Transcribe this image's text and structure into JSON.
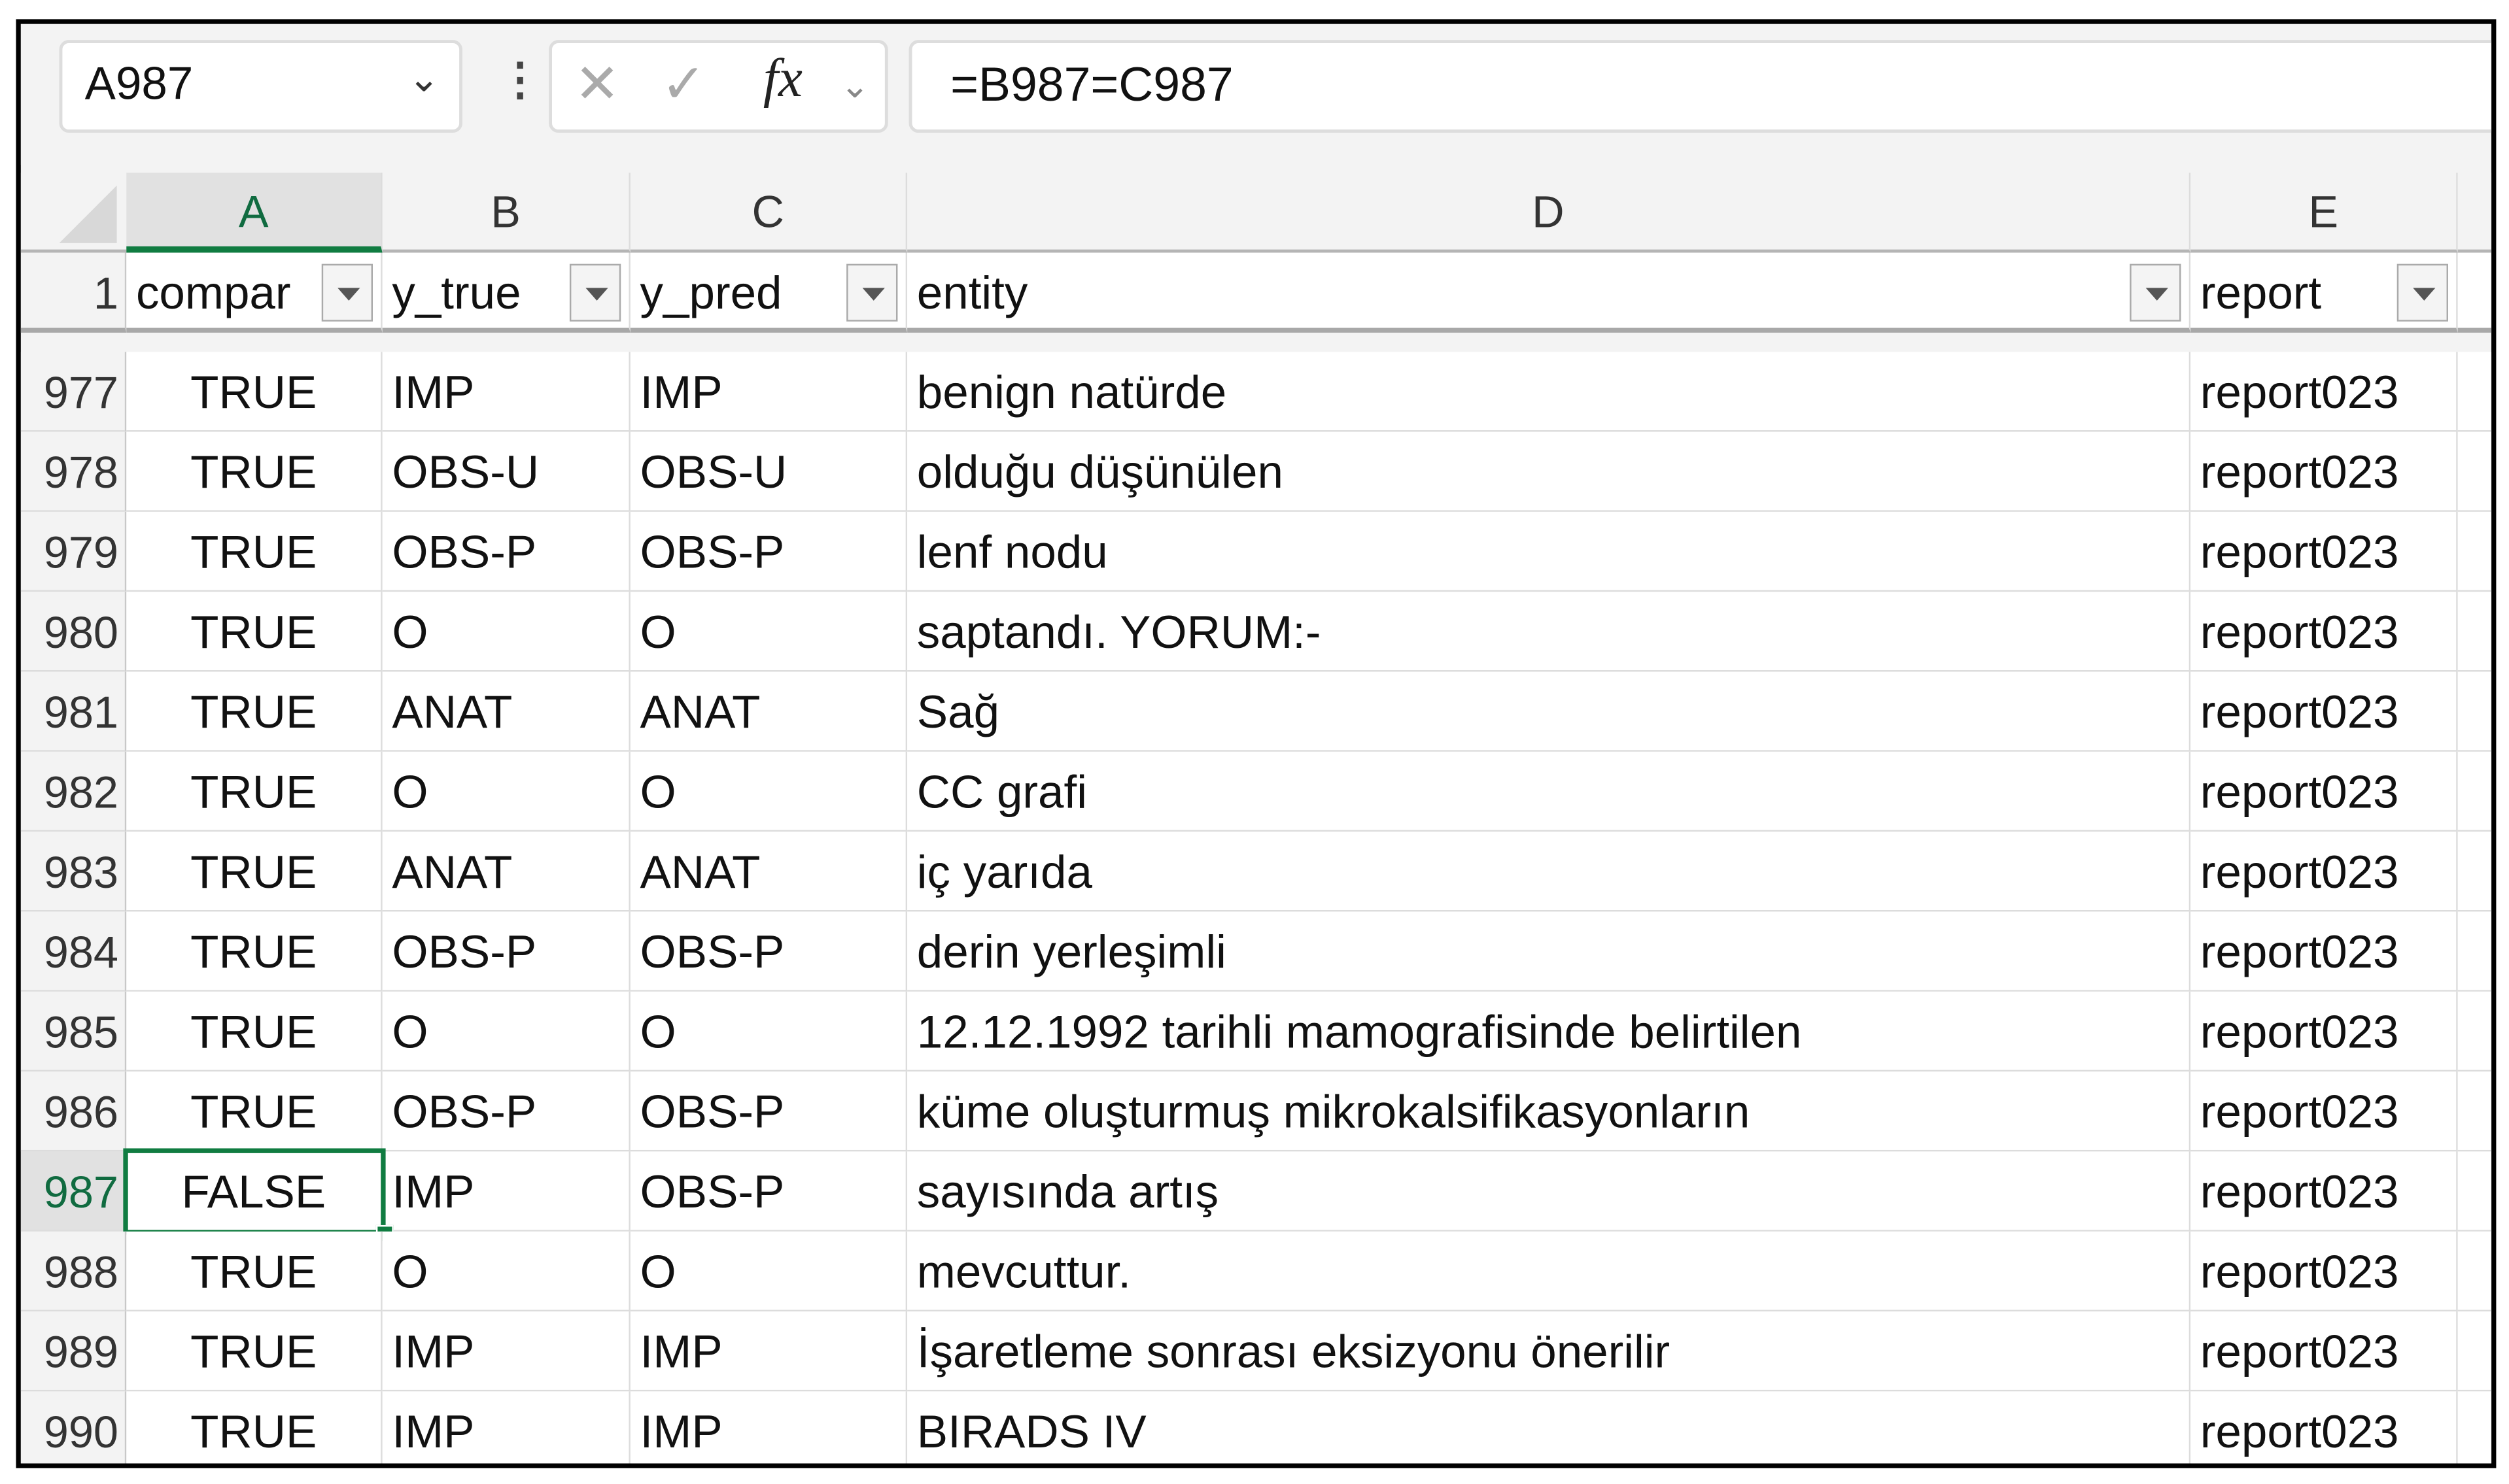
{
  "name_box": {
    "value": "A987"
  },
  "formula_bar": {
    "value": "=B987=C987",
    "cancel_icon": "x-icon",
    "enter_icon": "check-icon",
    "fx_label": "fx"
  },
  "columns": [
    "A",
    "B",
    "C",
    "D",
    "E"
  ],
  "header_row": {
    "number": "1",
    "cells": [
      "compar",
      "y_true",
      "y_pred",
      "entity",
      "report"
    ]
  },
  "selected_cell": "A987",
  "colors": {
    "accent": "#107c41"
  },
  "rows": [
    {
      "n": "977",
      "a": "TRUE",
      "b": "IMP",
      "c": "IMP",
      "d": "benign natürde",
      "e": "report023"
    },
    {
      "n": "978",
      "a": "TRUE",
      "b": "OBS-U",
      "c": "OBS-U",
      "d": "olduğu düşünülen",
      "e": "report023"
    },
    {
      "n": "979",
      "a": "TRUE",
      "b": "OBS-P",
      "c": "OBS-P",
      "d": "lenf nodu",
      "e": "report023"
    },
    {
      "n": "980",
      "a": "TRUE",
      "b": "O",
      "c": "O",
      "d": "saptandı. YORUM:-",
      "e": "report023"
    },
    {
      "n": "981",
      "a": "TRUE",
      "b": "ANAT",
      "c": "ANAT",
      "d": "Sağ",
      "e": "report023"
    },
    {
      "n": "982",
      "a": "TRUE",
      "b": "O",
      "c": "O",
      "d": "CC grafi",
      "e": "report023"
    },
    {
      "n": "983",
      "a": "TRUE",
      "b": "ANAT",
      "c": "ANAT",
      "d": "iç yarıda",
      "e": "report023"
    },
    {
      "n": "984",
      "a": "TRUE",
      "b": "OBS-P",
      "c": "OBS-P",
      "d": "derin yerleşimli",
      "e": "report023"
    },
    {
      "n": "985",
      "a": "TRUE",
      "b": "O",
      "c": "O",
      "d": "12.12.1992 tarihli mamografisinde belirtilen",
      "e": "report023"
    },
    {
      "n": "986",
      "a": "TRUE",
      "b": "OBS-P",
      "c": "OBS-P",
      "d": "küme oluşturmuş mikrokalsifikasyonların",
      "e": "report023"
    },
    {
      "n": "987",
      "a": "FALSE",
      "b": "IMP",
      "c": "OBS-P",
      "d": "sayısında artış",
      "e": "report023"
    },
    {
      "n": "988",
      "a": "TRUE",
      "b": "O",
      "c": "O",
      "d": "mevcuttur.",
      "e": "report023"
    },
    {
      "n": "989",
      "a": "TRUE",
      "b": "IMP",
      "c": "IMP",
      "d": "İşaretleme sonrası eksizyonu önerilir",
      "e": "report023"
    },
    {
      "n": "990",
      "a": "TRUE",
      "b": "IMP",
      "c": "IMP",
      "d": "BIRADS IV",
      "e": "report023"
    }
  ]
}
